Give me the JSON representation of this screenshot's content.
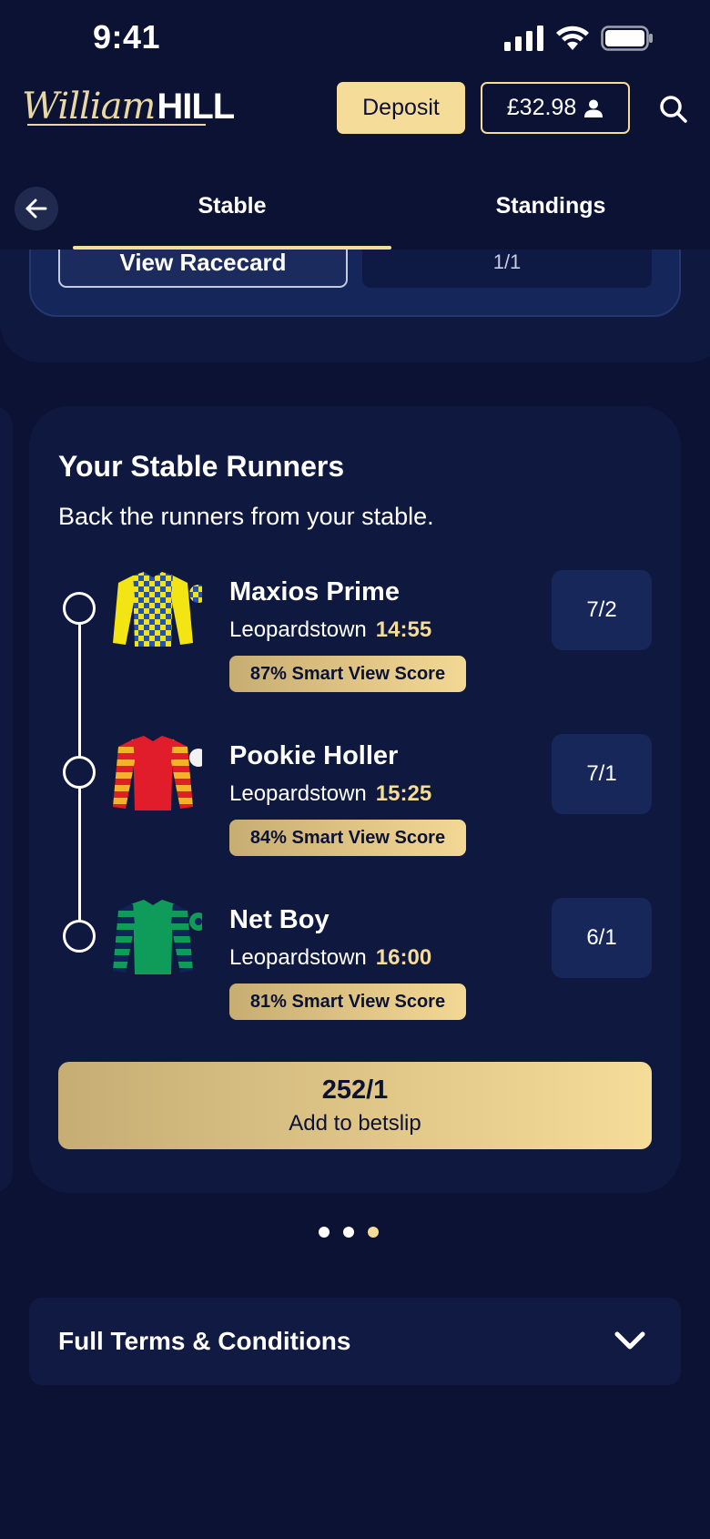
{
  "status_bar": {
    "time": "9:41",
    "icons": [
      "signal-icon",
      "wifi-icon",
      "battery-icon"
    ]
  },
  "header": {
    "logo_script": "William",
    "logo_bold": "HILL",
    "deposit_label": "Deposit",
    "balance": "£32.98",
    "balance_icon": "user-icon",
    "search_icon": "search-icon"
  },
  "tabs": {
    "back_icon": "arrow-left-icon",
    "items": [
      {
        "label": "Stable",
        "active": true
      },
      {
        "label": "Standings",
        "active": false
      }
    ]
  },
  "previous_card": {
    "racecard_label": "View Racecard",
    "odds": "1/1"
  },
  "stable_runners": {
    "title": "Your Stable Runners",
    "subtitle": "Back the runners from your stable.",
    "runners": [
      {
        "name": "Maxios Prime",
        "course": "Leopardstown",
        "time": "14:55",
        "score": "87% Smart View Score",
        "odds": "7/2",
        "silk": "yellow-blue-check-silk-icon"
      },
      {
        "name": "Pookie Holler",
        "course": "Leopardstown",
        "time": "15:25",
        "score": "84% Smart View Score",
        "odds": "7/1",
        "silk": "red-yellow-hoop-silk-icon"
      },
      {
        "name": "Net Boy",
        "course": "Leopardstown",
        "time": "16:00",
        "score": "81% Smart View Score",
        "odds": "6/1",
        "silk": "green-navy-hoop-silk-icon"
      }
    ],
    "betslip": {
      "odds": "252/1",
      "label": "Add to betslip"
    }
  },
  "pagination": {
    "count": 3,
    "active_index": 2
  },
  "terms": {
    "label": "Full Terms & Conditions",
    "icon": "chevron-down-icon"
  },
  "colors": {
    "background": "#0b1233",
    "card": "#0f183f",
    "accent": "#f6dc99",
    "odds_bg": "#18275a"
  }
}
